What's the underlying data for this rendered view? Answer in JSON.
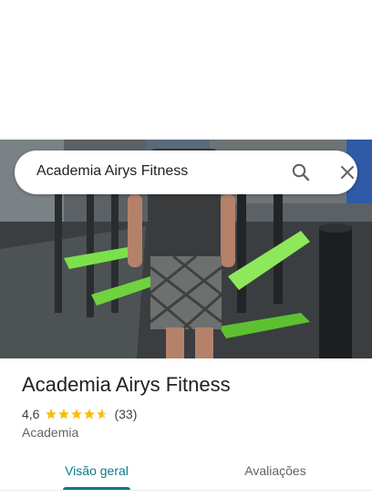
{
  "search": {
    "query": "Academia Airys Fitness"
  },
  "place": {
    "title": "Academia Airys Fitness",
    "rating": "4,6",
    "rating_value": 4.6,
    "stars_max": 5,
    "review_count": "(33)",
    "category": "Academia"
  },
  "tabs": [
    {
      "label": "Visão geral",
      "active": true
    },
    {
      "label": "Avaliações",
      "active": false
    }
  ],
  "colors": {
    "accent": "#0b7a8a",
    "star": "#fbbc04",
    "star_empty": "#dadce0",
    "equipment_green": "#7ce04a"
  },
  "icons": {
    "search": "search-icon",
    "close": "close-icon",
    "star": "star-icon"
  }
}
